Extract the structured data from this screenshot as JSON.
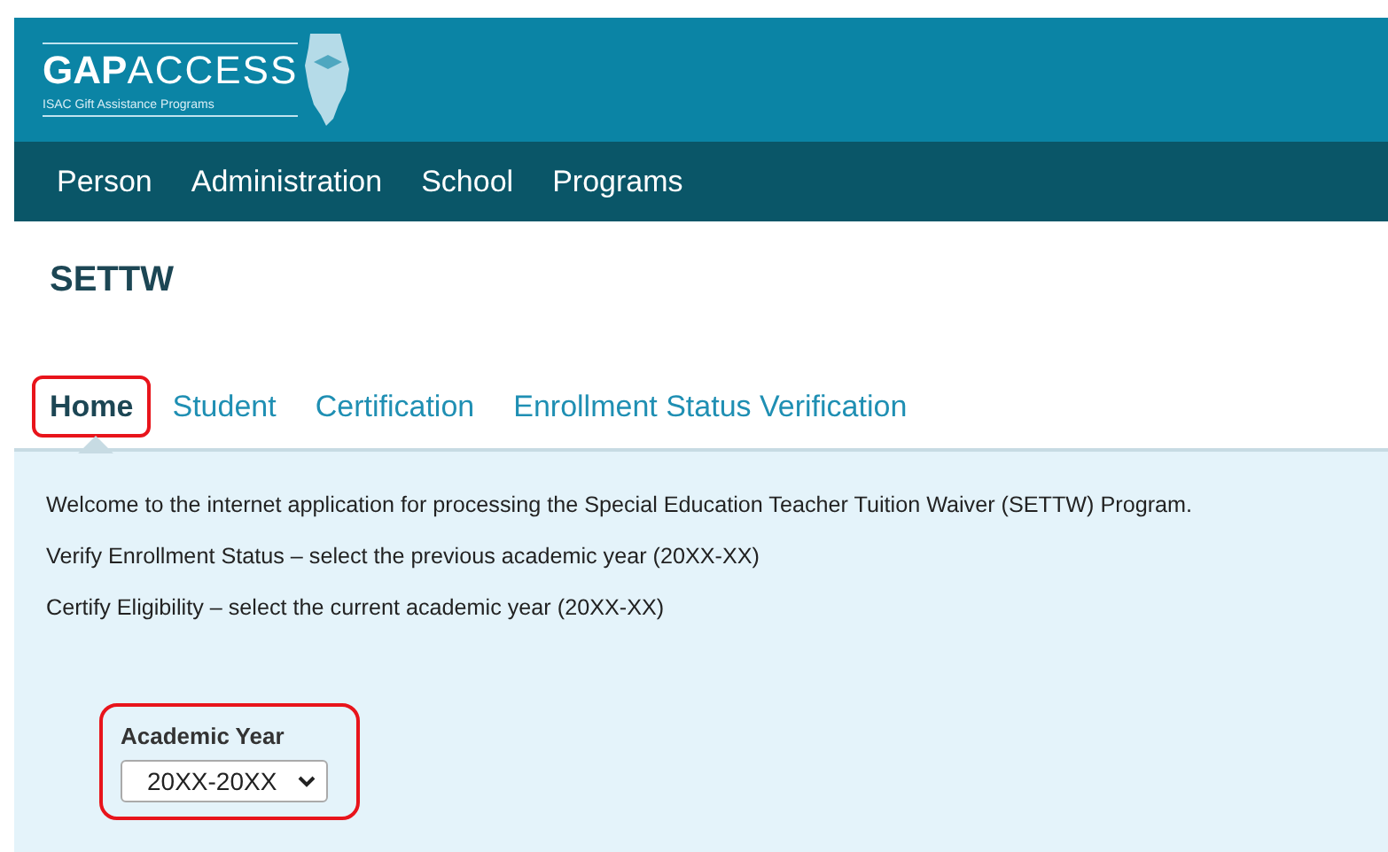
{
  "header": {
    "logo_title_bold": "GAP",
    "logo_title_light": "ACCESS",
    "logo_subtitle": "ISAC Gift Assistance Programs"
  },
  "nav": [
    {
      "label": "Person"
    },
    {
      "label": "Administration"
    },
    {
      "label": "School"
    },
    {
      "label": "Programs"
    }
  ],
  "page_title": "SETTW",
  "tabs": [
    {
      "label": "Home",
      "selected": true,
      "highlighted": true
    },
    {
      "label": "Student",
      "selected": false,
      "highlighted": false
    },
    {
      "label": "Certification",
      "selected": false,
      "highlighted": false
    },
    {
      "label": "Enrollment Status Verification",
      "selected": false,
      "highlighted": false
    }
  ],
  "paragraphs": [
    "Welcome to the internet application for processing the Special Education Teacher Tuition Waiver (SETTW) Program.",
    "Verify Enrollment Status – select the previous academic year (20XX-XX)",
    "Certify Eligibility – select the current academic year (20XX-XX)"
  ],
  "academic_year": {
    "label": "Academic Year",
    "value": "20XX-20XX",
    "highlighted": true
  }
}
